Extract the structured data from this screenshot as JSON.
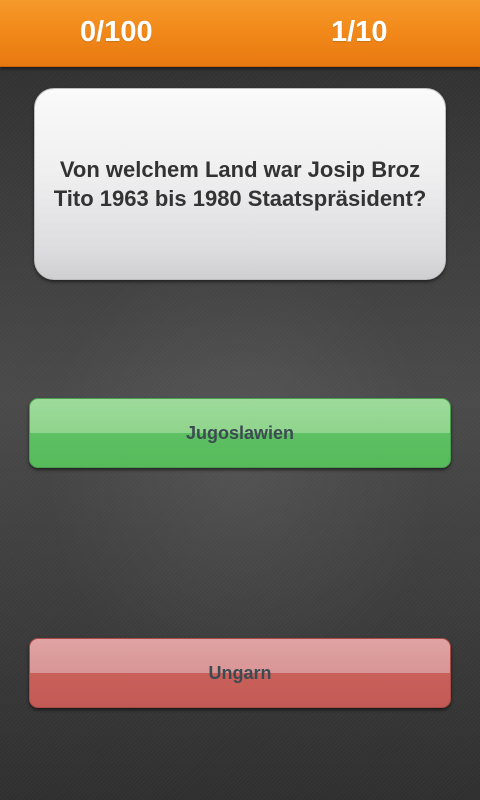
{
  "header": {
    "score": "0/100",
    "progress": "1/10"
  },
  "question": {
    "line1": "Von welchem Land war Josip Broz",
    "line2": "Tito 1963 bis 1980 Staatspräsident?"
  },
  "answers": [
    {
      "label": "Jugoslawien",
      "state": "correct",
      "color": "#5dc063"
    },
    {
      "label": "Ungarn",
      "state": "wrong",
      "color": "#c9605a"
    }
  ],
  "colors": {
    "accent": "#f28a1a",
    "question_text": "#333333",
    "answer_text": "#3c4a52"
  }
}
